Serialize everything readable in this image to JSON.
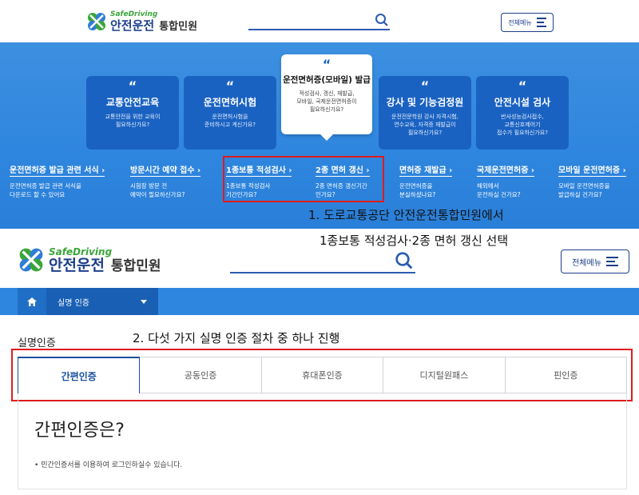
{
  "top_header": {
    "logo_small": "SafeDriving",
    "logo_main": "안전운전",
    "logo_sub": "통합민원",
    "menu_label": "전체메뉴"
  },
  "banner": {
    "cards": [
      {
        "quote": "“",
        "title": "교통안전교육",
        "desc1": "교통안전을 위한 교육이",
        "desc2": "필요하신가요?",
        "desc3": ""
      },
      {
        "quote": "“",
        "title": "운전면허시험",
        "desc1": "운전면허시험을",
        "desc2": "준비하시고 계신가요?",
        "desc3": ""
      },
      {
        "quote": "“",
        "title": "운전면허증(모바일) 발급",
        "desc1": "적성검사, 갱신, 재발급,",
        "desc2": "모바일, 국제운전면허증이",
        "desc3": "필요하신가요?"
      },
      {
        "quote": "“",
        "title": "강사 및 기능검정원",
        "desc1": "운전전문학원 강사 자격시험,",
        "desc2": "연수교육, 자격증 재발급이",
        "desc3": "필요하신가요?"
      },
      {
        "quote": "“",
        "title": "안전시설 검사",
        "desc1": "반사성능검사접수,",
        "desc2": "교통신호제어기",
        "desc3": "접수가 필요하신가요?"
      }
    ],
    "links": [
      {
        "title": "운전면허증 발급 관련 서식",
        "desc1": "운전면허증 발급 관련 서식을",
        "desc2": "다운로드 할 수 있어요"
      },
      {
        "title": "방문시간 예약 접수",
        "desc1": "시험장 방문 전",
        "desc2": "예약이 필요하신가요?"
      },
      {
        "title": "1종보통 적성검사",
        "desc1": "1종보통 적성검사",
        "desc2": "기간인가요?"
      },
      {
        "title": "2종 면허 갱신",
        "desc1": "2종 면허증 갱신기간",
        "desc2": "인가요?"
      },
      {
        "title": "면허증 재발급",
        "desc1": "운전면허증을",
        "desc2": "분실하셨나요?"
      },
      {
        "title": "국제운전면허증",
        "desc1": "해외에서",
        "desc2": "운전하실 건가요?"
      },
      {
        "title": "모바일 운전면허증",
        "desc1": "모바일 운전면허증을",
        "desc2": "발급하실 건가요?"
      }
    ]
  },
  "annotations": {
    "step1_line1": "1. 도로교통공단 안전운전통합민원에서",
    "step1_line2": "1종보통 적성검사·2종 면허 갱신 선택",
    "step2": "2. 다섯 가지 실명 인증 절차 중 하나 진행"
  },
  "second_header": {
    "logo_small": "SafeDriving",
    "logo_main": "안전운전",
    "logo_sub": "통합민원",
    "menu_label": "전체메뉴"
  },
  "nav": {
    "crumb": "실명 인증"
  },
  "auth": {
    "section_title": "실명인증",
    "tabs": [
      "간편인증",
      "공동인증",
      "휴대폰인증",
      "디지털원패스",
      "핀인증"
    ],
    "panel_title": "간편인증은?",
    "panel_bullet": "민간인증서를 이용하여 로그인하실수 있습니다."
  },
  "colors": {
    "brand_navy": "#1d3f8a",
    "brand_green": "#3aa63a",
    "banner_blue": "#2f86de",
    "card_blue": "#1a62c2",
    "highlight_red": "#e01b1b"
  }
}
